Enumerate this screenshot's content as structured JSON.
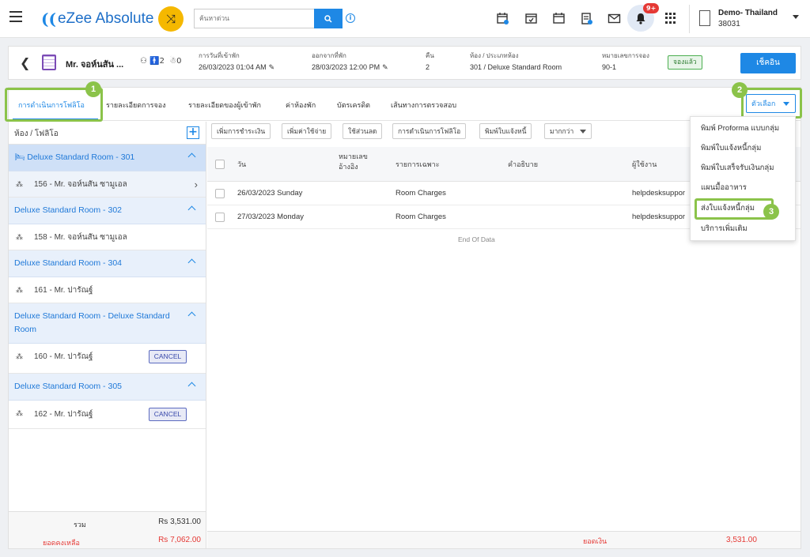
{
  "topbar": {
    "logo_mark": "((",
    "logo_text": "eZee Absolute",
    "search_placeholder": "ค้นหาด่วน",
    "notification_count": "9+",
    "hotel_name": "Demo- Thailand",
    "hotel_code": "38031"
  },
  "reservation": {
    "guest_name": "Mr. จอห์นสัน ...",
    "pax_adults": "2",
    "pax_children": "0",
    "checkin_label": "การวันที่เข้าพัก",
    "checkin_value": "26/03/2023 01:04 AM",
    "checkout_label": "ออกจากที่พัก",
    "checkout_value": "28/03/2023 12:00 PM",
    "nights_label": "คืน",
    "nights_value": "2",
    "room_label": "ห้อง / ประเภทห้อง",
    "room_value": "301 / Deluxe Standard Room",
    "resno_label": "หมายเลขการจอง",
    "resno_value": "90-1",
    "status": "จองแล้ว",
    "checkout_button": "เช็คอิน"
  },
  "tabs": [
    {
      "label": "การดำเนินการโฟลิโอ"
    },
    {
      "label": "รายละเอียดการจอง"
    },
    {
      "label": "รายละเอียดของผู้เข้าพัก"
    },
    {
      "label": "ค่าห้องพัก"
    },
    {
      "label": "บัตรเครดิต"
    },
    {
      "label": "เส้นทางการตรวจสอบ"
    }
  ],
  "steps": [
    "1",
    "2",
    "3"
  ],
  "options_button": "ตัวเลือก",
  "left_list": {
    "header": "ห้อง / โฟลิโอ",
    "add_symbol": "+",
    "groups": [
      {
        "room": "Deluxe Standard Room - 301",
        "guest": "156 - Mr. จอห์นสัน ซามูเอล"
      },
      {
        "room": "Deluxe Standard Room - 302",
        "guest": "158 - Mr. จอห์นสัน ซามูเอล"
      },
      {
        "room": "Deluxe Standard Room - 304",
        "guest": "161 - Mr. ปารัณฐ์"
      },
      {
        "room": "Deluxe Standard Room - Deluxe Standard Room",
        "guest": "160 - Mr. ปารัณฐ์",
        "tag": "CANCEL"
      },
      {
        "room": "Deluxe Standard Room - 305",
        "guest": "162 - Mr. ปารัณฐ์",
        "tag": "CANCEL"
      }
    ],
    "total_label": "รวม",
    "total_value": "Rs 3,531.00",
    "balance_label": "ยอดคงเหลือ",
    "balance_value": "Rs 7,062.00"
  },
  "toolbar": {
    "add_payment": "เพิ่มการชำระเงิน",
    "add_charge": "เพิ่มค่าใช้จ่าย",
    "apply_discount": "ใช้ส่วนลด",
    "folio_operations": "การดำเนินการโฟลิโอ",
    "print_invoice": "พิมพ์ใบแจ้งหนี้",
    "more": "มากกว่า"
  },
  "grid": {
    "col_date": "วัน",
    "col_ref_1": "หมายเลข",
    "col_ref_2": "อ้างอิง",
    "col_particulars": "รายการเฉพาะ",
    "col_description": "คำอธิบาย",
    "col_user": "ผู้ใช้งาน",
    "rows": [
      {
        "date": "26/03/2023 Sunday",
        "particulars": "Room Charges",
        "user": "helpdesksuppor"
      },
      {
        "date": "27/03/2023 Monday",
        "particulars": "Room Charges",
        "user": "helpdesksuppor"
      }
    ],
    "end_of_data": "End Of Data",
    "footer_label": "ยอดเงิน",
    "footer_value": "3,531.00"
  },
  "dropdown": [
    "พิมพ์ Proforma แบบกลุ่ม",
    "พิมพ์ใบแจ้งหนี้กลุ่ม",
    "พิมพ์ใบเสร็จรับเงินกลุ่ม",
    "แผนมื้ออาหาร",
    "ส่งใบแจ้งหนี้กลุ่ม",
    "บริการเพิ่มเติม"
  ],
  "colors": {
    "primary": "#1e88e5",
    "highlight": "#8bc34a",
    "danger": "#e53935",
    "shuffle": "#f5b800"
  }
}
